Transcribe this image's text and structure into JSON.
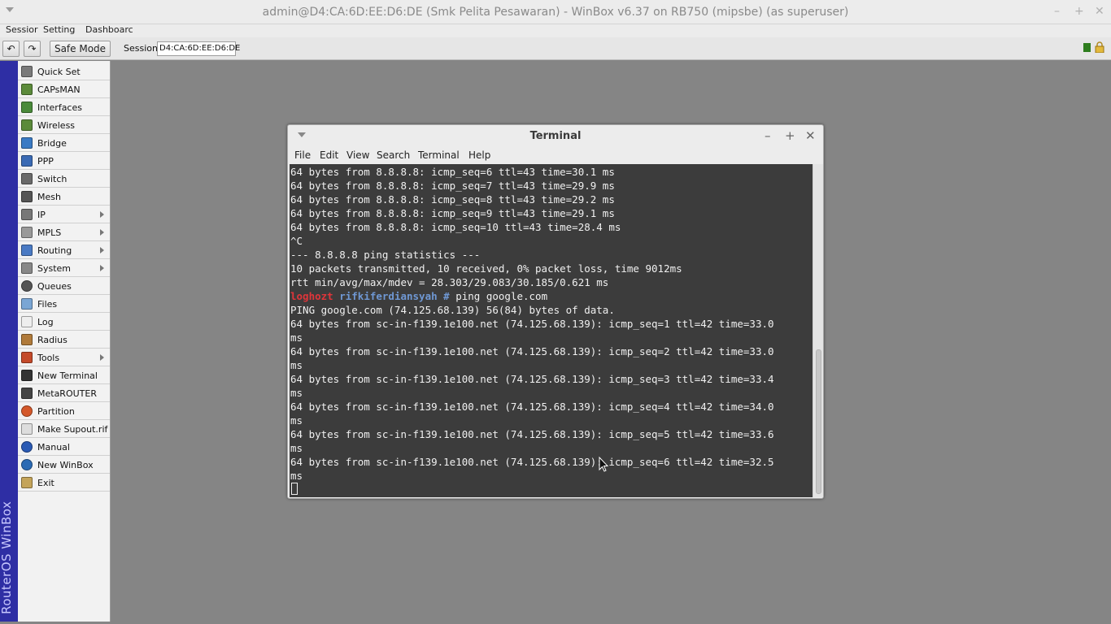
{
  "window": {
    "title": "admin@D4:CA:6D:EE:D6:DE (Smk Pelita Pesawaran) - WinBox v6.37 on RB750 (mipsbe) (as superuser)",
    "minimize": "–",
    "maximize": "+",
    "close": "✕"
  },
  "menubar": {
    "session": "Sessior",
    "settings": "Setting",
    "dashboard": "Dashboarc"
  },
  "toolbar": {
    "undo": "↶",
    "redo": "↷",
    "safe_mode": "Safe Mode",
    "session_label": "Session",
    "session_value": "D4:CA:6D:EE:D6:DE"
  },
  "sidebar": {
    "brand": "RouterOS WinBox",
    "items": [
      {
        "label": "Quick Set",
        "icon": "quick-set-icon",
        "submenu": false
      },
      {
        "label": "CAPsMAN",
        "icon": "capsman-icon",
        "submenu": false
      },
      {
        "label": "Interfaces",
        "icon": "interfaces-icon",
        "submenu": false
      },
      {
        "label": "Wireless",
        "icon": "wireless-icon",
        "submenu": false
      },
      {
        "label": "Bridge",
        "icon": "bridge-icon",
        "submenu": false
      },
      {
        "label": "PPP",
        "icon": "ppp-icon",
        "submenu": false
      },
      {
        "label": "Switch",
        "icon": "switch-icon",
        "submenu": false
      },
      {
        "label": "Mesh",
        "icon": "mesh-icon",
        "submenu": false
      },
      {
        "label": "IP",
        "icon": "ip-icon",
        "submenu": true
      },
      {
        "label": "MPLS",
        "icon": "mpls-icon",
        "submenu": true
      },
      {
        "label": "Routing",
        "icon": "routing-icon",
        "submenu": true
      },
      {
        "label": "System",
        "icon": "system-icon",
        "submenu": true
      },
      {
        "label": "Queues",
        "icon": "queues-icon",
        "submenu": false
      },
      {
        "label": "Files",
        "icon": "files-icon",
        "submenu": false
      },
      {
        "label": "Log",
        "icon": "log-icon",
        "submenu": false
      },
      {
        "label": "Radius",
        "icon": "radius-icon",
        "submenu": false
      },
      {
        "label": "Tools",
        "icon": "tools-icon",
        "submenu": true
      },
      {
        "label": "New Terminal",
        "icon": "terminal-icon",
        "submenu": false
      },
      {
        "label": "MetaROUTER",
        "icon": "metarouter-icon",
        "submenu": false
      },
      {
        "label": "Partition",
        "icon": "partition-icon",
        "submenu": false
      },
      {
        "label": "Make Supout.rif",
        "icon": "supout-icon",
        "submenu": false
      },
      {
        "label": "Manual",
        "icon": "manual-icon",
        "submenu": false
      },
      {
        "label": "New WinBox",
        "icon": "winbox-icon",
        "submenu": false
      },
      {
        "label": "Exit",
        "icon": "exit-icon",
        "submenu": false
      }
    ]
  },
  "terminal": {
    "title": "Terminal",
    "minimize": "–",
    "maximize": "+",
    "close": "✕",
    "menu": [
      "File",
      "Edit",
      "View",
      "Search",
      "Terminal",
      "Help"
    ],
    "prompt": {
      "host": "loghozt",
      "user": "rifkiferdiansyah",
      "symbol": "#",
      "command": " ping google.com"
    },
    "lines_before_prompt": [
      "64 bytes from 8.8.8.8: icmp_seq=6 ttl=43 time=30.1 ms",
      "64 bytes from 8.8.8.8: icmp_seq=7 ttl=43 time=29.9 ms",
      "64 bytes from 8.8.8.8: icmp_seq=8 ttl=43 time=29.2 ms",
      "64 bytes from 8.8.8.8: icmp_seq=9 ttl=43 time=29.1 ms",
      "64 bytes from 8.8.8.8: icmp_seq=10 ttl=43 time=28.4 ms",
      "^C",
      "--- 8.8.8.8 ping statistics ---",
      "10 packets transmitted, 10 received, 0% packet loss, time 9012ms",
      "rtt min/avg/max/mdev = 28.303/29.083/30.185/0.621 ms"
    ],
    "lines_after_prompt": [
      "PING google.com (74.125.68.139) 56(84) bytes of data.",
      "64 bytes from sc-in-f139.1e100.net (74.125.68.139): icmp_seq=1 ttl=42 time=33.0",
      "ms",
      "64 bytes from sc-in-f139.1e100.net (74.125.68.139): icmp_seq=2 ttl=42 time=33.0",
      "ms",
      "64 bytes from sc-in-f139.1e100.net (74.125.68.139): icmp_seq=3 ttl=42 time=33.4",
      "ms",
      "64 bytes from sc-in-f139.1e100.net (74.125.68.139): icmp_seq=4 ttl=42 time=34.0",
      "ms",
      "64 bytes from sc-in-f139.1e100.net (74.125.68.139): icmp_seq=5 ttl=42 time=33.6",
      "ms",
      "64 bytes from sc-in-f139.1e100.net (74.125.68.139): icmp_seq=6 ttl=42 time=32.5",
      "ms"
    ]
  },
  "colors": {
    "desktop": "#858585",
    "sidebar_brand": "#2e2ea4",
    "terminal_bg": "#3c3c3c",
    "prompt_host": "#e0353a",
    "prompt_user": "#6f98d4"
  }
}
